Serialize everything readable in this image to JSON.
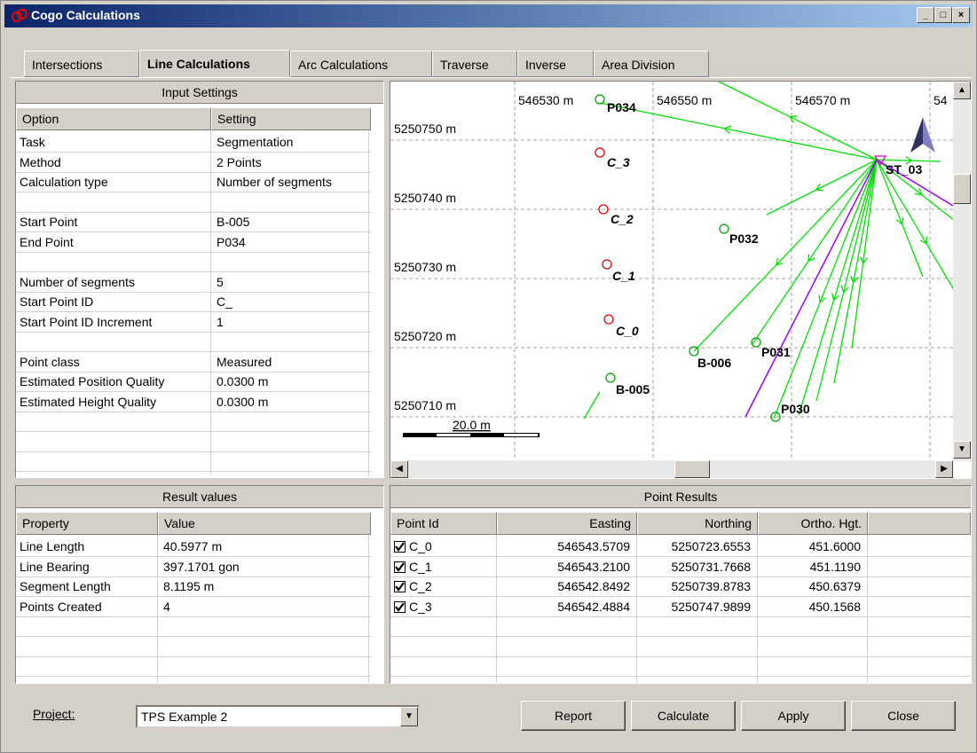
{
  "window": {
    "title": "Cogo Calculations"
  },
  "tabs": [
    {
      "label": "Intersections"
    },
    {
      "label": "Line Calculations"
    },
    {
      "label": "Arc Calculations"
    },
    {
      "label": "Traverse"
    },
    {
      "label": "Inverse"
    },
    {
      "label": "Area Division"
    }
  ],
  "input_settings": {
    "title": "Input Settings",
    "col_option": "Option",
    "col_setting": "Setting",
    "rows": [
      {
        "option": "Task",
        "setting": "Segmentation"
      },
      {
        "option": "Method",
        "setting": "2 Points"
      },
      {
        "option": "Calculation type",
        "setting": "Number of segments"
      },
      {
        "option": "",
        "setting": ""
      },
      {
        "option": "Start Point",
        "setting": "B-005"
      },
      {
        "option": "End Point",
        "setting": "P034"
      },
      {
        "option": "",
        "setting": ""
      },
      {
        "option": "Number of segments",
        "setting": "5"
      },
      {
        "option": "Start Point ID",
        "setting": "C_"
      },
      {
        "option": "Start Point ID Increment",
        "setting": "1"
      },
      {
        "option": "",
        "setting": ""
      },
      {
        "option": "Point class",
        "setting": "Measured"
      },
      {
        "option": "Estimated Position Quality",
        "setting": " 0.0300 m"
      },
      {
        "option": "Estimated Height Quality",
        "setting": " 0.0300 m"
      }
    ]
  },
  "result_values": {
    "title": "Result values",
    "col_property": "Property",
    "col_value": "Value",
    "rows": [
      {
        "property": "Line Length",
        "value": " 40.5977 m"
      },
      {
        "property": "Line Bearing",
        "value": " 397.1701 gon"
      },
      {
        "property": "Segment Length",
        "value": " 8.1195 m"
      },
      {
        "property": "Points Created",
        "value": "4"
      }
    ]
  },
  "point_results": {
    "title": "Point Results",
    "columns": [
      "Point Id",
      "Easting",
      "Northing",
      "Ortho. Hgt."
    ],
    "rows": [
      {
        "id": "C_0",
        "easting": "546543.5709",
        "northing": "5250723.6553",
        "hgt": "451.6000",
        "checked": true
      },
      {
        "id": "C_1",
        "easting": "546543.2100",
        "northing": "5250731.7668",
        "hgt": "451.1190",
        "checked": true
      },
      {
        "id": "C_2",
        "easting": "546542.8492",
        "northing": "5250739.8783",
        "hgt": "450.6379",
        "checked": true
      },
      {
        "id": "C_3",
        "easting": "546542.4884",
        "northing": "5250747.9899",
        "hgt": "450.1568",
        "checked": true
      }
    ]
  },
  "map": {
    "x_labels": [
      "546530 m",
      "546550 m",
      "546570 m",
      "54"
    ],
    "y_labels": [
      "5250750 m",
      "5250740 m",
      "5250730 m",
      "5250720 m",
      "5250710 m"
    ],
    "scale_label": "20.0 m",
    "points": [
      {
        "label": "P034",
        "color": "green"
      },
      {
        "label": "C_3",
        "color": "red"
      },
      {
        "label": "C_2",
        "color": "red"
      },
      {
        "label": "C_1",
        "color": "red"
      },
      {
        "label": "C_0",
        "color": "red"
      },
      {
        "label": "B-005",
        "color": "green"
      },
      {
        "label": "B-006",
        "color": "green"
      },
      {
        "label": "P031",
        "color": "green"
      },
      {
        "label": "P032",
        "color": "green"
      },
      {
        "label": "P030",
        "color": "green"
      },
      {
        "label": "ST_03",
        "color": "magenta"
      }
    ],
    "colors": {
      "observation": "#00e000",
      "line": "#9900ff",
      "grid": "#a0a0a0"
    }
  },
  "footer": {
    "project_label": "Project:",
    "project_value": "TPS Example 2",
    "buttons": {
      "report": "Report",
      "calculate": "Calculate",
      "apply": "Apply",
      "close": "Close"
    }
  }
}
